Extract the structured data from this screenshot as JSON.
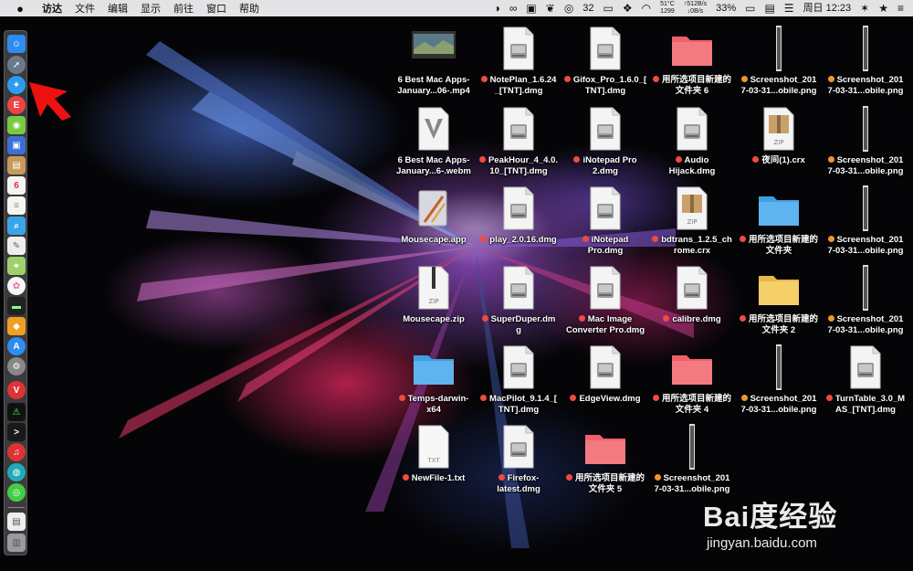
{
  "menubar": {
    "apple": "",
    "menus": [
      "访达",
      "文件",
      "编辑",
      "显示",
      "前往",
      "窗口",
      "帮助"
    ],
    "status": {
      "wechat_badge": "32",
      "temp": "51°C",
      "fan": "1299",
      "net_up": "↑512B/s",
      "net_down": "↓0B/s",
      "battery": "33%",
      "clock": "周日 12:23"
    }
  },
  "files": [
    {
      "name": "video-6best",
      "line1": "6 Best Mac Apps-",
      "line2": "January...06-.mp4",
      "dot": "",
      "type": "video"
    },
    {
      "name": "notepan",
      "line1": "NotePlan_1.6.24",
      "line2": "_[TNT].dmg",
      "dot": "red",
      "type": "dmg"
    },
    {
      "name": "gifox",
      "line1": "Gifox_Pro_1.6.0_[",
      "line2": "TNT].dmg",
      "dot": "red",
      "type": "dmg"
    },
    {
      "name": "folder6",
      "line1": "用所选项目新建的",
      "line2": "文件夹 6",
      "dot": "red",
      "type": "folder-red"
    },
    {
      "name": "shot1",
      "line1": "Screenshot_201",
      "line2": "7-03-31...obile.png",
      "dot": "orange",
      "type": "phone"
    },
    {
      "name": "shot2",
      "line1": "Screenshot_201",
      "line2": "7-03-31...obile.png",
      "dot": "orange",
      "type": "phone"
    },
    {
      "name": "webm",
      "line1": "6 Best Mac Apps-",
      "line2": "January...6-.webm",
      "dot": "",
      "type": "webm"
    },
    {
      "name": "peakhour",
      "line1": "PeakHour_4_4.0.",
      "line2": "10_[TNT].dmg",
      "dot": "red",
      "type": "dmg"
    },
    {
      "name": "inotepad2",
      "line1": "iNotepad Pro",
      "line2": "2.dmg",
      "dot": "red",
      "type": "dmg"
    },
    {
      "name": "audiohijack",
      "line1": "Audio",
      "line2": "Hijack.dmg",
      "dot": "red",
      "type": "dmg"
    },
    {
      "name": "yejian",
      "line1": "夜间(1).crx",
      "line2": "",
      "dot": "red",
      "type": "zip-box"
    },
    {
      "name": "shot3",
      "line1": "Screenshot_201",
      "line2": "7-03-31...obile.png",
      "dot": "orange",
      "type": "phone"
    },
    {
      "name": "mousecape-app",
      "line1": "Mousecape.app",
      "line2": "",
      "dot": "",
      "type": "app"
    },
    {
      "name": "play",
      "line1": "play_2.0.16.dmg",
      "line2": "",
      "dot": "red",
      "type": "dmg"
    },
    {
      "name": "inotepad",
      "line1": "iNotepad",
      "line2": "Pro.dmg",
      "dot": "red",
      "type": "dmg"
    },
    {
      "name": "bdtrans",
      "line1": "bdtrans_1.2.5_ch",
      "line2": "rome.crx",
      "dot": "red",
      "type": "zip-box"
    },
    {
      "name": "folder",
      "line1": "用所选项目新建的",
      "line2": "文件夹",
      "dot": "red",
      "type": "folder-blue"
    },
    {
      "name": "shot4",
      "line1": "Screenshot_201",
      "line2": "7-03-31...obile.png",
      "dot": "orange",
      "type": "phone"
    },
    {
      "name": "mousecape-zip",
      "line1": "Mousecape.zip",
      "line2": "",
      "dot": "",
      "type": "zip"
    },
    {
      "name": "superduper",
      "line1": "SuperDuper.dm",
      "line2": "g",
      "dot": "red",
      "type": "dmg"
    },
    {
      "name": "macimage",
      "line1": "Mac Image",
      "line2": "Converter Pro.dmg",
      "dot": "red",
      "type": "dmg"
    },
    {
      "name": "calibre",
      "line1": "calibre.dmg",
      "line2": "",
      "dot": "red",
      "type": "dmg"
    },
    {
      "name": "folder2",
      "line1": "用所选项目新建的",
      "line2": "文件夹 2",
      "dot": "red",
      "type": "folder-yellow"
    },
    {
      "name": "shot5",
      "line1": "Screenshot_201",
      "line2": "7-03-31...obile.png",
      "dot": "orange",
      "type": "phone"
    },
    {
      "name": "temps",
      "line1": "Temps-darwin-",
      "line2": "x64",
      "dot": "red",
      "type": "folder-blue"
    },
    {
      "name": "macpilot",
      "line1": "MacPilot_9.1.4_[",
      "line2": "TNT].dmg",
      "dot": "red",
      "type": "dmg"
    },
    {
      "name": "edgeview",
      "line1": "EdgeView.dmg",
      "line2": "",
      "dot": "red",
      "type": "dmg"
    },
    {
      "name": "folder4",
      "line1": "用所选项目新建的",
      "line2": "文件夹 4",
      "dot": "red",
      "type": "folder-red"
    },
    {
      "name": "shot6",
      "line1": "Screenshot_201",
      "line2": "7-03-31...obile.png",
      "dot": "orange",
      "type": "phone"
    },
    {
      "name": "turntable",
      "line1": "TurnTable_3.0_M",
      "line2": "AS_[TNT].dmg",
      "dot": "red",
      "type": "dmg"
    },
    {
      "name": "newfile",
      "line1": "NewFile-1.txt",
      "line2": "",
      "dot": "red",
      "type": "txt"
    },
    {
      "name": "firefox",
      "line1": "Firefox-",
      "line2": "latest.dmg",
      "dot": "red",
      "type": "dmg"
    },
    {
      "name": "folder5",
      "line1": "用所选项目新建的",
      "line2": "文件夹 5",
      "dot": "red",
      "type": "folder-red"
    },
    {
      "name": "shot7",
      "line1": "Screenshot_201",
      "line2": "7-03-31...obile.png",
      "dot": "orange",
      "type": "phone"
    }
  ],
  "watermark": {
    "logo": "Bai度经验",
    "url": "jingyan.baidu.com"
  },
  "colors": {
    "dot_red": "#ef4b3f",
    "dot_orange": "#f0952c",
    "folder_red": "#f0606a",
    "folder_blue": "#5db4ee",
    "folder_yellow": "#f5cf6a"
  }
}
